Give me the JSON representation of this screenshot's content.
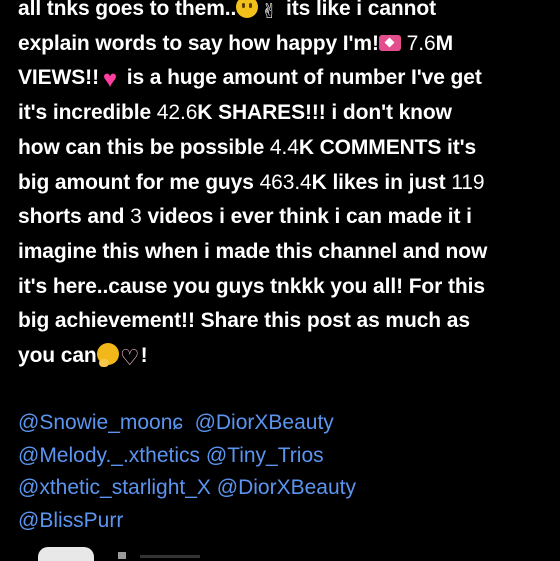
{
  "post": {
    "l1_a": "all tnks goes to them..",
    "l1_b": "its like i cannot",
    "l2_a": "explain words to say how happy I'm!",
    "l2_n": "7.6",
    "l2_b": "M",
    "l3_a": "VIEWS!!",
    "l3_b": "is a huge amount of number I've get",
    "l4_a": "it's incredible",
    "l4_n": "42.6",
    "l4_b": "K SHARES!!! i don't know",
    "l5_a": "how can this be possible",
    "l5_n": "4.4",
    "l5_b": "K COMMENTS it's",
    "l6_a": "big amount for me guys",
    "l6_n": "463.4",
    "l6_b": "K likes in just",
    "l6_n2": "119",
    "l7_a": "shorts and",
    "l7_n": "3",
    "l7_b": "videos i ever think i can made it i",
    "l8": "imagine this when i made this channel and now",
    "l9": "it's here..cause you guys tnkkk you all! For this",
    "l10": "big achievement!! Share this post as much as",
    "l11_a": "you can",
    "l11_b": "!"
  },
  "tags": {
    "t1": "@Snowie_moon",
    "t1_suffix": "ɕ",
    "t2": "@DiorXBeauty",
    "t3": "@Melody._.xthetics",
    "t4": "@Tiny_Trios",
    "t5": "@xthetic_starlight_X",
    "t6": "@DiorXBeauty",
    "t7": "@BlissPurr"
  },
  "emojis": {
    "smile": "slightly-smiling-face",
    "hand": "victory-hand",
    "letter": "love-letter",
    "heart": "pink-heart",
    "hug": "hugging-face",
    "hearthands": "heart-hands"
  }
}
